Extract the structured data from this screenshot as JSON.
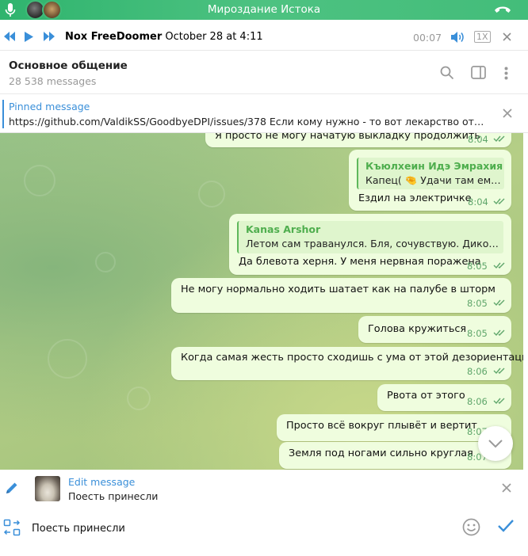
{
  "voice_chat": {
    "title": "Мироздание Истока",
    "bar_color": "#45bd7c"
  },
  "player": {
    "author": "Nox FreeDoomer",
    "date": "October 28 at 4:11",
    "time": "00:07",
    "speed": "1X"
  },
  "chat_header": {
    "title": "Основное общение",
    "subtitle": "28 538 messages"
  },
  "pinned": {
    "label": "Pinned message",
    "text": "https://github.com/ValdikSS/GoodbyeDPI/issues/378 Если кому нужно - то вот лекарство от зам..."
  },
  "messages": [
    {
      "text": "Я просто не могу начатую выкладку продолжить",
      "time": "8:04"
    },
    {
      "reply_name": "Къюлхеин Идэ Эмрахия",
      "reply_text": "Капец( 🤏 Удачи там ему...",
      "text": "Ездил на электричке",
      "time": "8:04"
    },
    {
      "reply_name": "Kanas Arshor",
      "reply_text": "Летом сам траванулся. Бля, сочувствую. Дико нен...",
      "text": "Да блевота херня. У меня нервная поражена",
      "time": "8:05"
    },
    {
      "text": "Не могу нормально ходить шатает как на палубе в шторм",
      "time": "8:05"
    },
    {
      "text": "Голова кружиться",
      "time": "8:05"
    },
    {
      "text": "Когда самая жесть просто сходишь с ума от этой дезориентации",
      "time": "8:06"
    },
    {
      "text": "Рвота от этого",
      "time": "8:06"
    },
    {
      "text": "Просто всё вокруг плывёт и вертит",
      "time": "8:07"
    },
    {
      "text": "Земля под ногами сильно круглая",
      "time": "8:07"
    }
  ],
  "edit": {
    "label": "Edit message",
    "text": "Поесть принесли"
  },
  "compose": {
    "value": "Поесть принесли"
  },
  "colors": {
    "accent": "#3a8fd9",
    "bubble": "#effdde",
    "time": "#5fa66b"
  },
  "icons": [
    "mic-icon",
    "hangup-icon",
    "prev-icon",
    "play-icon",
    "next-icon",
    "volume-icon",
    "close-icon",
    "search-icon",
    "sidebar-icon",
    "more-icon",
    "double-check-icon",
    "chevron-down-icon",
    "pencil-icon",
    "attach-icon",
    "emoji-icon",
    "send-check-icon"
  ]
}
